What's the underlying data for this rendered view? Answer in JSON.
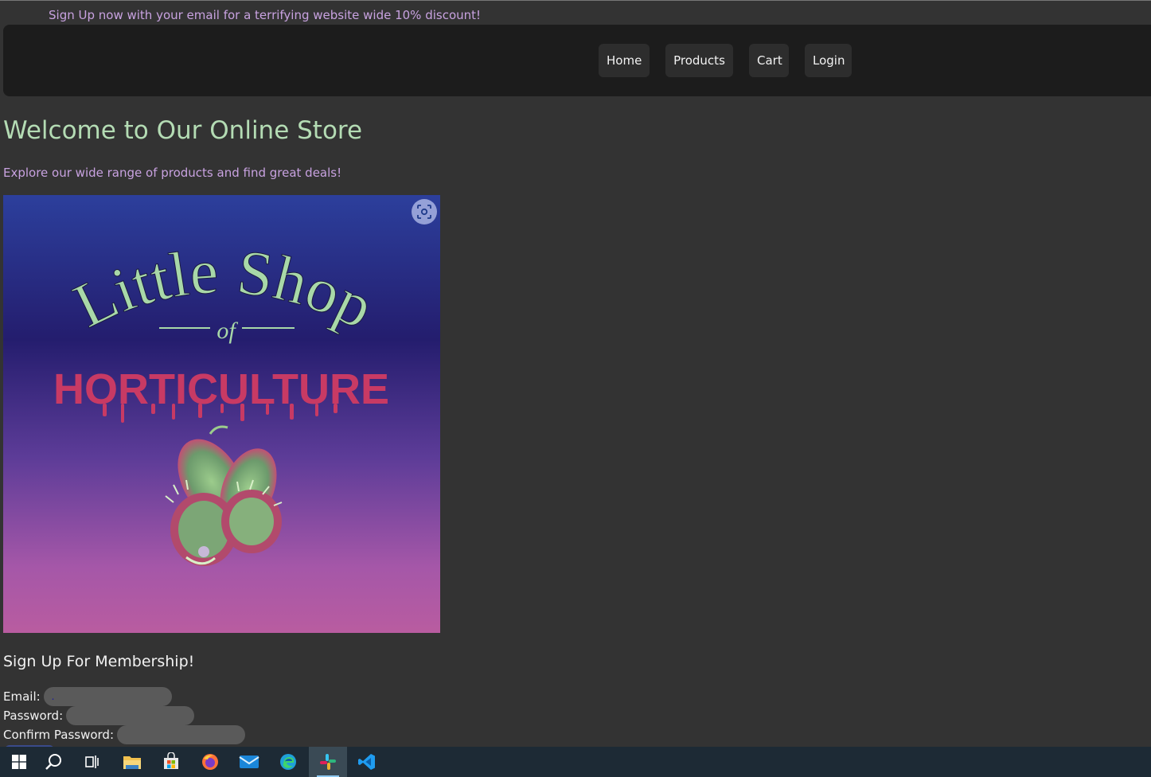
{
  "promo_banner": "Sign Up now with your email for a terrifying website wide 10% discount!",
  "nav": {
    "items": [
      {
        "label": "Home"
      },
      {
        "label": "Products"
      },
      {
        "label": "Cart"
      },
      {
        "label": "Login"
      }
    ]
  },
  "main": {
    "title": "Welcome to Our Online Store",
    "tagline": "Explore our wide range of products and find great deals!"
  },
  "hero_image": {
    "logo_line1": "Little Shop",
    "logo_of": "of",
    "logo_line2": "HORTICULTURE",
    "icon": "visual-search-icon"
  },
  "signup": {
    "title": "Sign Up For Membership!",
    "fields": [
      {
        "label": "Email:",
        "value": ".",
        "placeholder": ""
      },
      {
        "label": "Password:",
        "value": "",
        "placeholder": ""
      },
      {
        "label": "Confirm Password:",
        "value": "",
        "placeholder": ""
      }
    ]
  },
  "taskbar": {
    "icons": [
      "windows-start-icon",
      "search-icon",
      "task-view-icon",
      "file-explorer-icon",
      "microsoft-store-icon",
      "firefox-icon",
      "mail-icon",
      "edge-icon",
      "slack-icon",
      "vscode-icon"
    ],
    "active": "slack-icon"
  },
  "colors": {
    "page_bg": "#333333",
    "navbar_bg": "#1c1c1c",
    "title": "#b4dcb4",
    "accent_purple": "#c8a2e0",
    "logo_green": "#a8d8a8",
    "logo_pink": "#c83a64"
  }
}
